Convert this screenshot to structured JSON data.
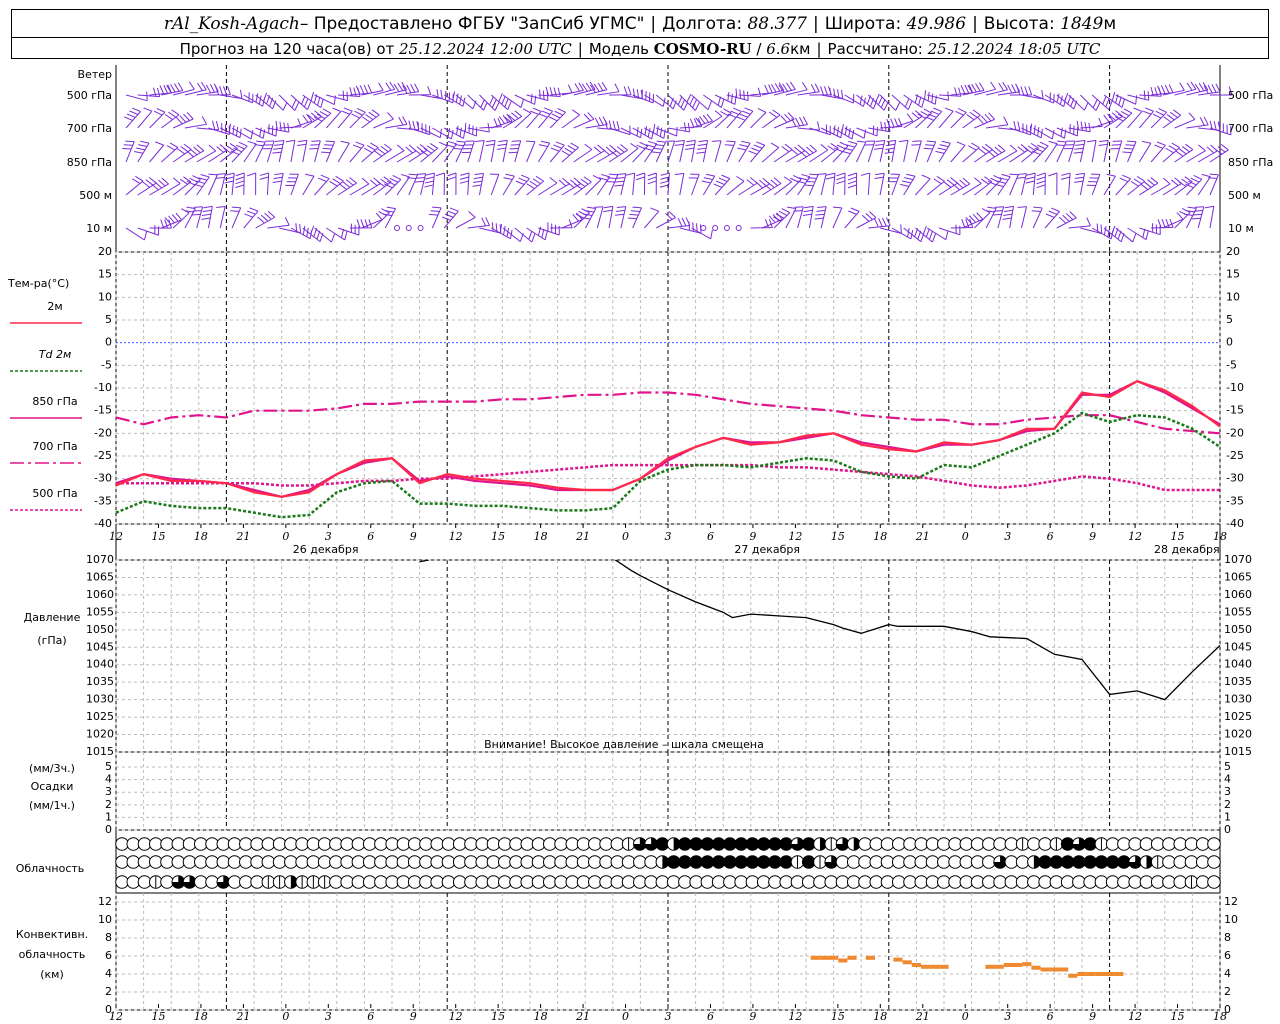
{
  "header": {
    "station": "rAl_Kosh-Agach",
    "provider": " – Предоставлено ФГБУ \"ЗапСиб УГМС\"",
    "lon_label": "Долгота:",
    "lon": "88.377",
    "lat_label": "Широта:",
    "lat": "49.986",
    "alt_label": "Высота:",
    "alt": "1849",
    "alt_unit": "м",
    "forecast_prefix": "Прогноз на 120 часа(ов) от",
    "forecast_time": "25.12.2024 12:00 UTC",
    "model_label": "Модель",
    "model": "COSMO-RU",
    "model_res": "6.6",
    "model_res_unit": "км",
    "calc_label": "Рассчитано:",
    "calc_time": "25.12.2024 18:05 UTC"
  },
  "wind_panel": {
    "title": "Ветер",
    "levels": [
      "500 гПа",
      "700 гПа",
      "850 гПа",
      "500 м",
      "10 м"
    ]
  },
  "temp_panel": {
    "title": "Тем-ра(°C)",
    "legend": [
      {
        "label": "2м",
        "color": "#ff2a4a",
        "style": "solid"
      },
      {
        "label": "Td 2м",
        "color": "#1a7a1a",
        "style": "dotted"
      },
      {
        "label": "850 гПа",
        "color": "#e0148c",
        "style": "solid"
      },
      {
        "label": "700 гПа",
        "color": "#e0148c",
        "style": "dashdot"
      },
      {
        "label": "500 гПа",
        "color": "#e0148c",
        "style": "dotted"
      }
    ]
  },
  "pressure_panel": {
    "title": "Давление",
    "unit": "(гПа)",
    "warning": "Внимание! Высокое давление – шкала смещена"
  },
  "precip_panel": {
    "unit3": "(мм/3ч.)",
    "title": "Осадки",
    "unit1": "(мм/1ч.)"
  },
  "cloud_panel": {
    "title": "Облачность",
    "rows": [
      [
        0,
        0,
        0,
        0,
        0,
        0,
        0,
        0,
        0,
        0,
        0,
        0,
        0,
        0,
        0,
        0,
        0,
        0,
        0,
        0,
        0,
        0,
        0,
        0,
        0,
        0,
        0,
        0,
        0,
        0,
        0,
        0,
        0,
        0,
        0,
        0,
        0,
        0,
        0,
        0,
        0,
        0,
        0,
        0,
        0,
        1,
        3,
        3,
        4,
        2,
        4,
        4,
        4,
        4,
        4,
        4,
        4,
        4,
        4,
        4,
        3,
        4,
        2,
        1,
        3,
        2,
        0,
        0,
        0,
        0,
        0,
        0,
        0,
        0,
        0,
        0,
        0,
        0,
        0,
        0,
        1,
        0,
        0,
        1,
        4,
        3,
        4,
        1,
        0,
        0,
        0,
        0,
        0,
        0,
        0,
        0,
        0,
        0
      ],
      [
        0,
        0,
        0,
        0,
        0,
        0,
        0,
        0,
        0,
        0,
        0,
        0,
        0,
        0,
        0,
        0,
        0,
        0,
        0,
        0,
        0,
        0,
        0,
        0,
        0,
        0,
        0,
        0,
        0,
        0,
        0,
        0,
        0,
        0,
        0,
        0,
        0,
        0,
        0,
        0,
        0,
        0,
        0,
        0,
        0,
        0,
        0,
        0,
        2,
        4,
        4,
        4,
        4,
        4,
        4,
        4,
        4,
        4,
        4,
        4,
        1,
        4,
        1,
        3,
        0,
        0,
        0,
        0,
        0,
        0,
        0,
        0,
        0,
        0,
        0,
        0,
        0,
        0,
        3,
        0,
        0,
        2,
        4,
        4,
        4,
        4,
        4,
        4,
        4,
        4,
        3,
        2,
        1,
        0,
        0,
        0,
        0,
        0
      ],
      [
        0,
        0,
        0,
        1,
        0,
        3,
        3,
        0,
        0,
        3,
        0,
        0,
        0,
        1,
        1,
        2,
        1,
        1,
        1,
        0,
        0,
        0,
        0,
        0,
        0,
        0,
        0,
        0,
        0,
        0,
        0,
        0,
        0,
        0,
        0,
        0,
        0,
        0,
        0,
        0,
        0,
        0,
        0,
        0,
        0,
        0,
        0,
        0,
        0,
        0,
        0,
        0,
        0,
        0,
        0,
        0,
        0,
        0,
        0,
        0,
        0,
        0,
        0,
        0,
        0,
        0,
        0,
        0,
        0,
        0,
        0,
        0,
        0,
        0,
        0,
        0,
        0,
        0,
        0,
        0,
        0,
        0,
        0,
        0,
        0,
        0,
        0,
        0,
        0,
        0,
        0,
        0,
        0,
        0,
        0,
        1,
        0,
        0
      ]
    ]
  },
  "conv_panel": {
    "line1": "Конвективн.",
    "line2": "облачность",
    "line3": "(км)"
  },
  "day_labels": [
    "26 декабря",
    "27 декабря",
    "28 декабря"
  ],
  "hour_ticks": [
    "12",
    "15",
    "18",
    "21",
    "0",
    "3",
    "6",
    "9",
    "12",
    "15",
    "18",
    "21",
    "0",
    "3",
    "6",
    "9",
    "12",
    "15",
    "18",
    "21",
    "0",
    "3",
    "6",
    "9",
    "12",
    "15",
    "18"
  ],
  "chart_data": [
    {
      "type": "line",
      "title": "Тем-ра(°C)",
      "x_hours": [
        0,
        3,
        6,
        9,
        12,
        15,
        18,
        21,
        24,
        27,
        30,
        33,
        36,
        39,
        42,
        45,
        48,
        51,
        54,
        57,
        60,
        63,
        66,
        69,
        72,
        75,
        78,
        81,
        84,
        87,
        90,
        93,
        96,
        99,
        102,
        105,
        108,
        111,
        114,
        117,
        120,
        123,
        126,
        129,
        132,
        135,
        138,
        141,
        144,
        147,
        150,
        153,
        156,
        159,
        162,
        165,
        168,
        171,
        174,
        177,
        180,
        183,
        186,
        189,
        192,
        195,
        198,
        201,
        204,
        207,
        210,
        213,
        216,
        219,
        222,
        225,
        228,
        231,
        234,
        237,
        240,
        243,
        246,
        249,
        252,
        255,
        258,
        261,
        264,
        267,
        270,
        273,
        276,
        279,
        282,
        285,
        288,
        291,
        294
      ],
      "ylim": [
        -40,
        20
      ],
      "series": [
        {
          "name": "2м",
          "color": "#ff2a4a",
          "x": [
            0,
            3,
            6,
            9,
            12,
            15,
            18,
            21,
            24,
            27,
            30,
            33,
            36,
            39,
            42,
            45,
            48,
            51,
            54,
            57,
            60,
            63,
            66,
            69,
            72,
            75,
            78,
            81,
            84,
            87,
            90,
            93,
            96,
            99,
            102,
            105,
            108,
            111,
            114,
            117,
            120
          ],
          "values": [
            -31.5,
            -29.0,
            -30.5,
            -30.5,
            -31.0,
            -33.0,
            -34.0,
            -33.0,
            -29.0,
            -26.0,
            -25.5,
            -31.0,
            -29.0,
            -30.0,
            -30.5,
            -31.0,
            -32.0,
            -32.5,
            -32.5,
            -30.0,
            -25.5,
            -23.0,
            -21.0,
            -22.5,
            -22.0,
            -20.5,
            -20.0,
            -22.5,
            -23.5,
            -24.0,
            -22.0,
            -22.5,
            -21.5,
            -19.0,
            -19.0,
            -11.0,
            -12.0,
            -8.5,
            -10.5,
            -14.0,
            -18.5
          ]
        },
        {
          "name": "Td 2м",
          "color": "#1a7a1a",
          "x": [
            0,
            3,
            6,
            9,
            12,
            15,
            18,
            21,
            24,
            27,
            30,
            33,
            36,
            39,
            42,
            45,
            48,
            51,
            54,
            57,
            60,
            63,
            66,
            69,
            72,
            75,
            78,
            81,
            84,
            87,
            90,
            93,
            96,
            99,
            102,
            105,
            108,
            111,
            114,
            117,
            120
          ],
          "values": [
            -37.5,
            -35.0,
            -36.0,
            -36.5,
            -36.5,
            -37.5,
            -38.5,
            -38.0,
            -33.0,
            -31.0,
            -30.5,
            -35.5,
            -35.5,
            -36.0,
            -36.0,
            -36.5,
            -37.0,
            -37.0,
            -36.5,
            -30.5,
            -28.0,
            -27.0,
            -27.0,
            -27.5,
            -26.5,
            -25.5,
            -26.0,
            -28.5,
            -29.5,
            -30.0,
            -27.0,
            -27.5,
            -25.0,
            -22.5,
            -20.0,
            -15.5,
            -17.5,
            -16.0,
            -16.5,
            -19.0,
            -23.0
          ]
        },
        {
          "name": "850 гПа",
          "color": "#e0148c",
          "x": [
            0,
            3,
            6,
            9,
            12,
            15,
            18,
            21,
            24,
            27,
            30,
            33,
            36,
            39,
            42,
            45,
            48,
            51,
            54,
            57,
            60,
            63,
            66,
            69,
            72,
            75,
            78,
            81,
            84,
            87,
            90,
            93,
            96,
            99,
            102,
            105,
            108,
            111,
            114,
            117,
            120
          ],
          "values": [
            -31.0,
            -29.0,
            -30.0,
            -30.5,
            -31.0,
            -32.5,
            -34.0,
            -32.5,
            -29.0,
            -26.5,
            -25.5,
            -30.5,
            -29.5,
            -30.5,
            -31.0,
            -31.5,
            -32.5,
            -32.5,
            -32.5,
            -30.0,
            -26.0,
            -23.0,
            -21.0,
            -22.0,
            -22.0,
            -21.0,
            -20.0,
            -22.0,
            -23.0,
            -24.0,
            -22.5,
            -22.5,
            -21.5,
            -19.5,
            -19.0,
            -11.5,
            -11.5,
            -8.5,
            -11.0,
            -14.5,
            -18.0
          ]
        },
        {
          "name": "700 гПа",
          "color": "#e0148c",
          "x": [
            0,
            3,
            6,
            9,
            12,
            15,
            18,
            21,
            24,
            27,
            30,
            33,
            36,
            39,
            42,
            45,
            48,
            51,
            54,
            57,
            60,
            63,
            66,
            69,
            72,
            75,
            78,
            81,
            84,
            87,
            90,
            93,
            96,
            99,
            102,
            105,
            108,
            111,
            114,
            117,
            120
          ],
          "values": [
            -16.5,
            -18.0,
            -16.5,
            -16.0,
            -16.5,
            -15.0,
            -15.0,
            -15.0,
            -14.5,
            -13.5,
            -13.5,
            -13.0,
            -13.0,
            -13.0,
            -12.5,
            -12.5,
            -12.0,
            -11.5,
            -11.5,
            -11.0,
            -11.0,
            -11.5,
            -12.5,
            -13.5,
            -14.0,
            -14.5,
            -15.0,
            -16.0,
            -16.5,
            -17.0,
            -17.0,
            -18.0,
            -18.0,
            -17.0,
            -16.5,
            -16.0,
            -16.0,
            -17.5,
            -19.0,
            -19.5,
            -20.0
          ]
        },
        {
          "name": "500 гПа",
          "color": "#e0148c",
          "x": [
            0,
            3,
            6,
            9,
            12,
            15,
            18,
            21,
            24,
            27,
            30,
            33,
            36,
            39,
            42,
            45,
            48,
            51,
            54,
            57,
            60,
            63,
            66,
            69,
            72,
            75,
            78,
            81,
            84,
            87,
            90,
            93,
            96,
            99,
            102,
            105,
            108,
            111,
            114,
            117,
            120
          ],
          "values": [
            -31.0,
            -31.0,
            -31.0,
            -31.0,
            -31.0,
            -31.0,
            -31.5,
            -31.5,
            -31.0,
            -30.5,
            -30.5,
            -30.0,
            -30.0,
            -29.5,
            -29.0,
            -28.5,
            -28.0,
            -27.5,
            -27.0,
            -27.0,
            -27.0,
            -27.0,
            -27.0,
            -27.0,
            -27.5,
            -27.5,
            -28.0,
            -28.5,
            -29.0,
            -29.5,
            -30.5,
            -31.5,
            -32.0,
            -31.5,
            -30.5,
            -29.5,
            -30.0,
            -31.0,
            -32.5,
            -32.5,
            -32.5
          ]
        }
      ]
    },
    {
      "type": "line",
      "title": "Давление",
      "ylabel": "(гПа)",
      "ylim": [
        1015,
        1070
      ],
      "y_ticks": [
        1015,
        1020,
        1025,
        1030,
        1035,
        1040,
        1045,
        1050,
        1055,
        1060,
        1065,
        1070
      ],
      "series": [
        {
          "name": "Давление",
          "color": "#000000",
          "x": [
            33,
            34,
            54,
            56,
            57,
            60,
            63,
            66,
            67,
            69,
            72,
            75,
            78,
            79,
            81,
            84,
            85,
            87,
            90,
            93,
            95,
            99,
            102,
            105,
            108,
            111,
            114,
            117,
            120
          ],
          "values": [
            1069.5,
            1070.0,
            1070.5,
            1067.0,
            1065.5,
            1061.5,
            1058.0,
            1055.0,
            1053.5,
            1054.5,
            1054.0,
            1053.5,
            1051.5,
            1050.5,
            1049.0,
            1051.5,
            1051.0,
            1051.0,
            1051.0,
            1049.5,
            1048.0,
            1047.5,
            1043.0,
            1041.5,
            1031.5,
            1032.5,
            1030.0,
            1038.0,
            1045.5
          ]
        }
      ]
    },
    {
      "type": "bar",
      "title": "Конвективн. облачность",
      "ylabel": "(км)",
      "ylim": [
        0,
        13
      ],
      "y_ticks": [
        0,
        2,
        4,
        6,
        8,
        10,
        12
      ],
      "series": [
        {
          "name": "Конвективн. облачность",
          "color": "#f08a30",
          "x": [
            76,
            77,
            78,
            79,
            80,
            82,
            85,
            86,
            87,
            88,
            89,
            90,
            95,
            96,
            97,
            98,
            99,
            100,
            101,
            102,
            103,
            104,
            105,
            106,
            107,
            108,
            109
          ],
          "values": [
            5.8,
            5.8,
            5.8,
            5.5,
            5.8,
            5.8,
            5.6,
            5.3,
            5.0,
            4.8,
            4.8,
            4.8,
            4.8,
            4.8,
            5.0,
            5.0,
            5.1,
            4.7,
            4.5,
            4.5,
            4.5,
            3.8,
            4.0,
            4.0,
            4.0,
            4.0,
            4.0
          ]
        }
      ]
    }
  ]
}
